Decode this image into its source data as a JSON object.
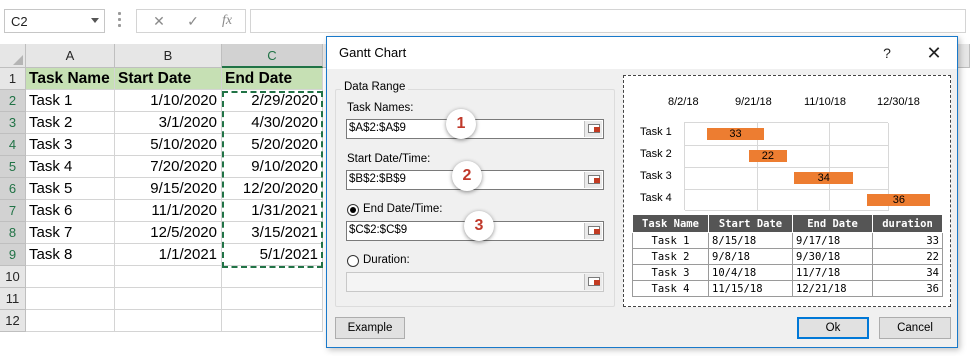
{
  "formula_bar": {
    "name_box": "C2",
    "cancel_icon": "✕",
    "enter_icon": "✓",
    "function_icon": "fx",
    "formula": ""
  },
  "grid": {
    "columns": [
      "A",
      "B",
      "C"
    ],
    "rows": [
      "1",
      "2",
      "3",
      "4",
      "5",
      "6",
      "7",
      "8",
      "9",
      "10",
      "11",
      "12"
    ],
    "header_row": [
      "Task Name",
      "Start Date",
      "End Date"
    ],
    "data_rows": [
      [
        "Task 1",
        "1/10/2020",
        "2/29/2020"
      ],
      [
        "Task 2",
        "3/1/2020",
        "4/30/2020"
      ],
      [
        "Task 3",
        "5/10/2020",
        "5/20/2020"
      ],
      [
        "Task 4",
        "7/20/2020",
        "9/10/2020"
      ],
      [
        "Task 5",
        "9/15/2020",
        "12/20/2020"
      ],
      [
        "Task 6",
        "11/1/2020",
        "1/31/2021"
      ],
      [
        "Task 7",
        "12/5/2020",
        "3/15/2021"
      ],
      [
        "Task 8",
        "1/1/2021",
        "5/1/2021"
      ]
    ]
  },
  "dialog": {
    "title": "Gantt Chart",
    "help": "?",
    "close": "✕",
    "group_label": "Data Range",
    "task_names_label": "Task Names:",
    "task_names_value": "$A$2:$A$9",
    "start_label": "Start Date/Time:",
    "start_value": "$B$2:$B$9",
    "end_label": "End Date/Time:",
    "end_value": "$C$2:$C$9",
    "duration_label": "Duration:",
    "duration_value": "",
    "badges": [
      "1",
      "2",
      "3"
    ],
    "example_button": "Example",
    "ok_button": "Ok",
    "cancel_button": "Cancel",
    "selected_mode": "End Date/Time"
  },
  "preview": {
    "dates": [
      "8/2/18",
      "9/21/18",
      "11/10/18",
      "12/30/18"
    ],
    "table_headers": [
      "Task Name",
      "Start Date",
      "End Date",
      "duration"
    ],
    "table_rows": [
      [
        "Task 1",
        "8/15/18",
        "9/17/18",
        "33"
      ],
      [
        "Task 2",
        "9/8/18",
        "9/30/18",
        "22"
      ],
      [
        "Task 3",
        "10/4/18",
        "11/7/18",
        "34"
      ],
      [
        "Task 4",
        "11/15/18",
        "12/21/18",
        "36"
      ]
    ],
    "bar_color": "#ed7d31"
  },
  "chart_data": {
    "type": "bar",
    "categories": [
      "Task 1",
      "Task 2",
      "Task 3",
      "Task 4"
    ],
    "start": [
      "8/15/18",
      "9/8/18",
      "10/4/18",
      "11/15/18"
    ],
    "end": [
      "9/17/18",
      "9/30/18",
      "11/7/18",
      "12/21/18"
    ],
    "values": [
      33,
      22,
      34,
      36
    ],
    "xticks": [
      "8/2/18",
      "9/21/18",
      "11/10/18",
      "12/30/18"
    ],
    "xlim": [
      "8/2/18",
      "12/30/18"
    ],
    "title": "",
    "xlabel": "",
    "ylabel": ""
  }
}
